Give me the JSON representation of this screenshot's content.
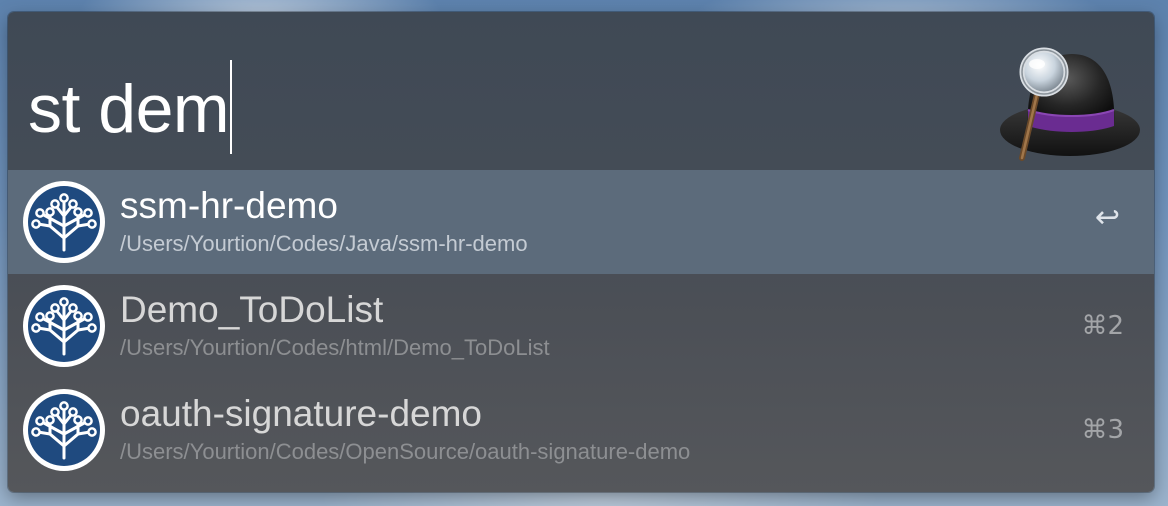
{
  "search": {
    "query": "st dem"
  },
  "results": [
    {
      "title": "ssm-hr-demo",
      "subtitle": "/Users/Yourtion/Codes/Java/ssm-hr-demo",
      "shortcut": "↩",
      "selected": true,
      "icon": "sourcetree-icon"
    },
    {
      "title": "Demo_ToDoList",
      "subtitle": "/Users/Yourtion/Codes/html/Demo_ToDoList",
      "shortcut": "⌘2",
      "selected": false,
      "icon": "sourcetree-icon"
    },
    {
      "title": "oauth-signature-demo",
      "subtitle": "/Users/Yourtion/Codes/OpenSource/oauth-signature-demo",
      "shortcut": "⌘3",
      "selected": false,
      "icon": "sourcetree-icon"
    }
  ],
  "colors": {
    "selected_row": "#5c6b7b",
    "icon_blue": "#1f4a7f",
    "hat_band": "#6a2c91"
  }
}
